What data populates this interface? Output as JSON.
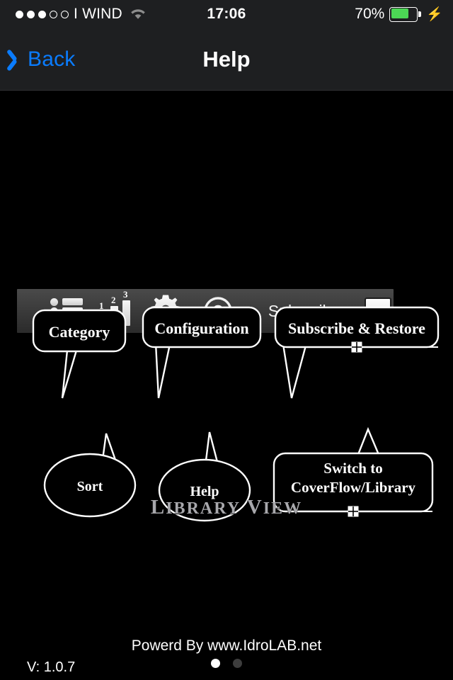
{
  "statusbar": {
    "signal_filled": 3,
    "signal_empty": 2,
    "carrier": "I WIND",
    "wifi_icon": "wifi-icon",
    "time": "17:06",
    "battery_percent_label": "70%",
    "battery_level": 70,
    "battery_fill_color": "#4cd755",
    "charging_icon": "lightning-bolt-icon"
  },
  "navbar": {
    "back_label": "Back",
    "back_icon": "chevron-left-icon",
    "title": "Help",
    "accent_color": "#0a7cff"
  },
  "toolbar": {
    "items": [
      {
        "name": "category-button",
        "icon": "bulleted-list-icon",
        "label": ""
      },
      {
        "name": "sort-button",
        "icon": "bar-chart-numbered-icon",
        "label": "",
        "numbers": [
          "1",
          "2",
          "3"
        ]
      },
      {
        "name": "configuration-button",
        "icon": "gear-icon",
        "label": ""
      },
      {
        "name": "help-button",
        "icon": "question-mark-circle-icon",
        "label": ""
      },
      {
        "name": "subscribe-button",
        "icon": "",
        "label": "Subscribe"
      },
      {
        "name": "coverflow-toggle-button",
        "icon": "filled-square-icon",
        "label": ""
      }
    ]
  },
  "callouts": [
    {
      "id": "category",
      "text": "Category",
      "shape": "rounded-rect"
    },
    {
      "id": "configuration",
      "text": "Configuration",
      "shape": "rounded-rect"
    },
    {
      "id": "subscribe-restore",
      "text": "Subscribe & Restore",
      "shape": "rounded-rect",
      "handle": true
    },
    {
      "id": "sort",
      "text": "Sort",
      "shape": "ellipse"
    },
    {
      "id": "help",
      "text": "Help",
      "shape": "ellipse"
    },
    {
      "id": "switch-coverflow",
      "text_line1": "Switch to",
      "text_line2": "CoverFlow/Library",
      "shape": "rounded-rect",
      "handle": true
    }
  ],
  "section": {
    "heading_first": "L",
    "heading_rest": "IBRARY",
    "heading_second_first": "V",
    "heading_second_rest": "IEW",
    "heading_full": "LIBRARY VIEW"
  },
  "footer": {
    "powered_by": "Powerd By www.IdroLAB.net",
    "version": "V:  1.0.7",
    "page_index": 1,
    "page_count": 2
  }
}
